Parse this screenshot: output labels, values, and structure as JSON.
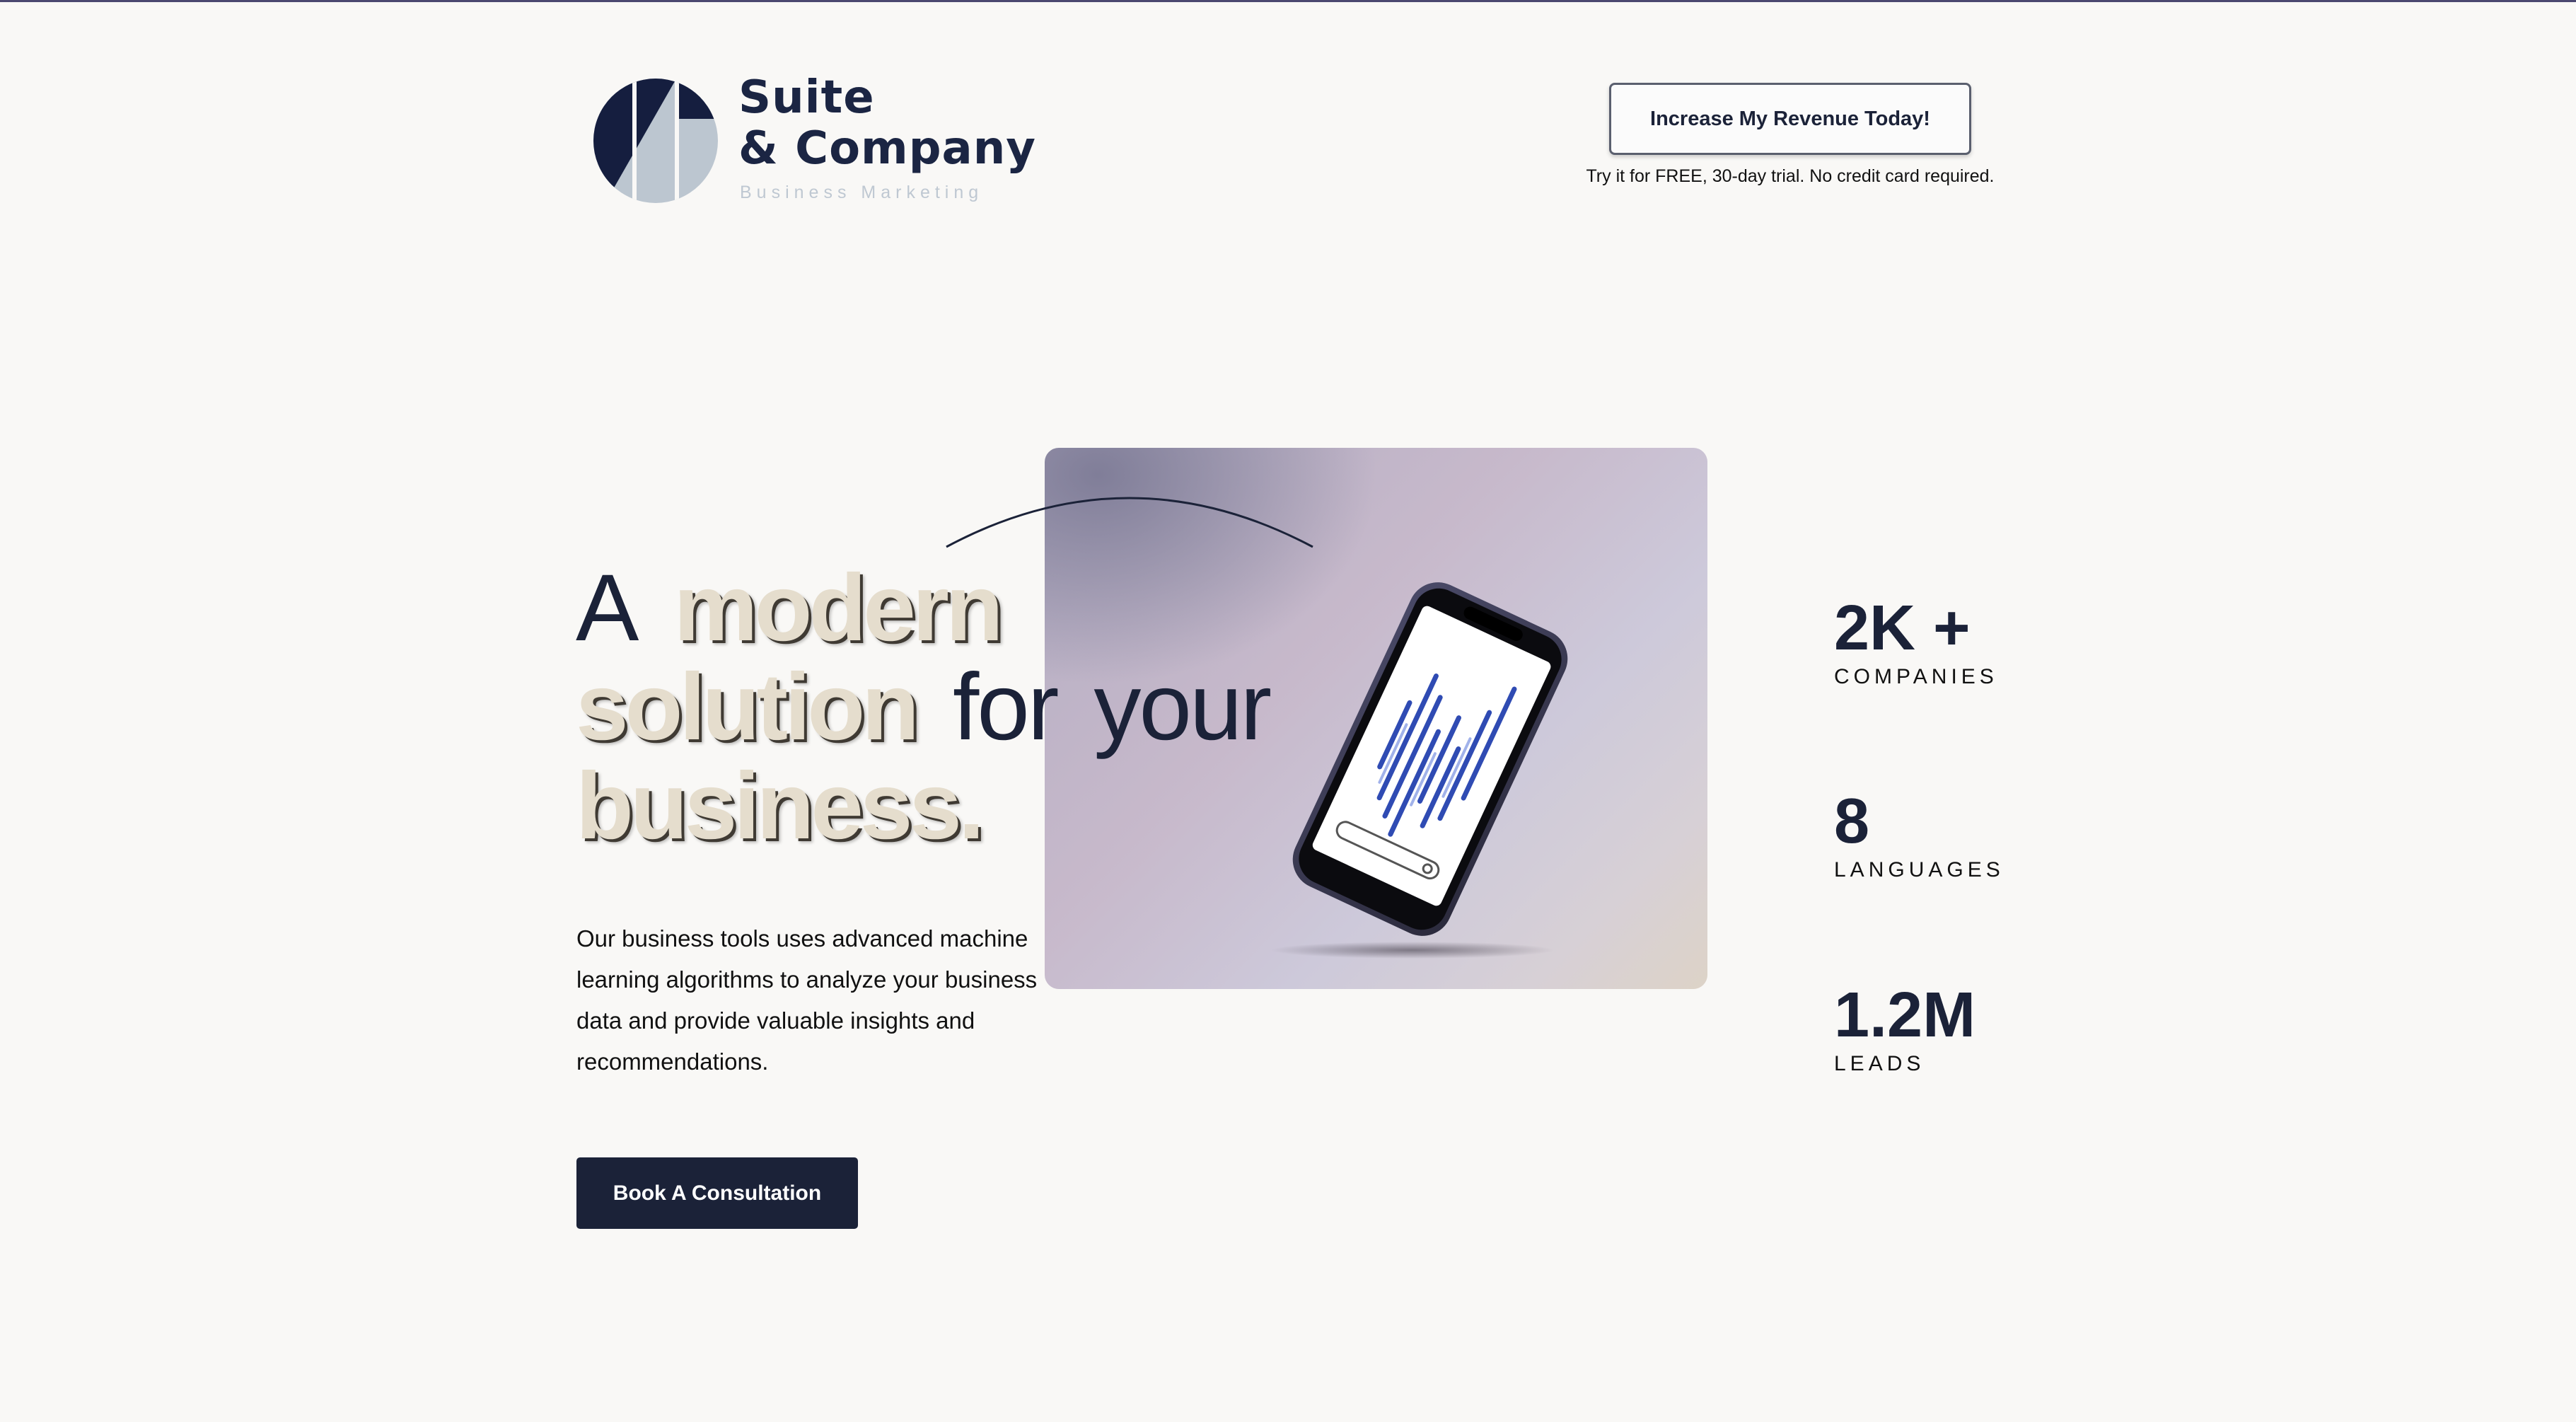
{
  "brand": {
    "name_line1": "Suite",
    "name_line2": "& Company",
    "tagline": "Business Marketing",
    "colors": {
      "navy": "#1b2543",
      "slate": "#bcc6d0"
    }
  },
  "header": {
    "cta_label": "Increase My Revenue Today!",
    "cta_note": "Try it for FREE, 30-day trial. No credit card required."
  },
  "hero": {
    "headline": {
      "word_a": "A",
      "word_modern": "modern",
      "word_solution": "solution",
      "word_for": "for",
      "word_your": "your",
      "word_business": "business."
    },
    "body": "Our business tools uses advanced machine learning algorithms to analyze your business data and provide valuable insights and recommendations.",
    "cta_label": "Book A Consultation",
    "image_icon": "smartphone-icon"
  },
  "stats": [
    {
      "value": "2K +",
      "label": "COMPANIES"
    },
    {
      "value": "8",
      "label": "LANGUAGES"
    },
    {
      "value": "1.2M",
      "label": "LEADS"
    }
  ],
  "colors": {
    "primary": "#1b2238",
    "highlight": "#e5ddcd",
    "background": "#f9f8f6"
  }
}
